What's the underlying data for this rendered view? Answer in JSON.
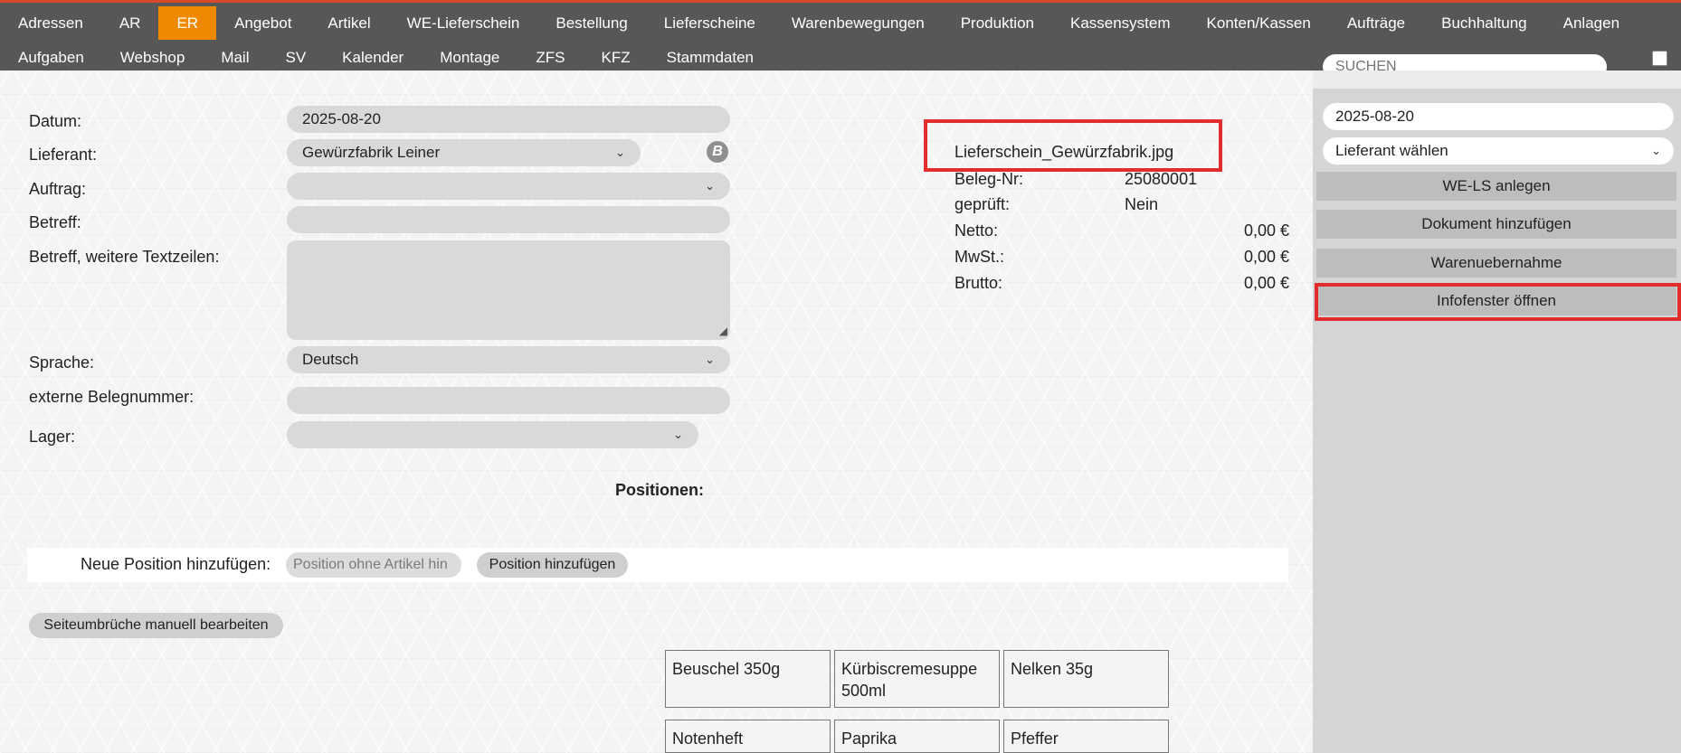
{
  "nav": {
    "row1": [
      "Adressen",
      "AR",
      "ER",
      "Angebot",
      "Artikel",
      "WE-Lieferschein",
      "Bestellung",
      "Lieferscheine",
      "Warenbewegungen",
      "Produktion",
      "Kassensystem",
      "Konten/Kassen",
      "Aufträge",
      "Buchhaltung",
      "Anlagen"
    ],
    "row2": [
      "Aufgaben",
      "Webshop",
      "Mail",
      "SV",
      "Kalender",
      "Montage",
      "ZFS",
      "KFZ",
      "Stammdaten"
    ],
    "active": "ER"
  },
  "sidebar": {
    "search_placeholder": "SUCHEN",
    "date": "2025-08-20",
    "supplier_select": "Lieferant wählen",
    "buttons": [
      "WE-LS anlegen",
      "Dokument hinzufügen",
      "Warenuebernahme",
      "Infofenster öffnen"
    ]
  },
  "form": {
    "datum_label": "Datum:",
    "datum_value": "2025-08-20",
    "lieferant_label": "Lieferant:",
    "lieferant_value": "Gewürzfabrik Leiner",
    "b_icon": "B",
    "auftrag_label": "Auftrag:",
    "auftrag_value": "",
    "betreff_label": "Betreff:",
    "betreff_value": "",
    "betreff_more_label": "Betreff, weitere Textzeilen:",
    "sprache_label": "Sprache:",
    "sprache_value": "Deutsch",
    "extern_label": "externe Belegnummer:",
    "extern_value": "",
    "lager_label": "Lager:",
    "lager_value": ""
  },
  "info": {
    "filename": "Lieferschein_Gewürzfabrik.jpg",
    "beleg_label": "Beleg-Nr:",
    "beleg_value": "25080001",
    "geprueft_label": "geprüft:",
    "geprueft_value": "Nein",
    "netto_label": "Netto:",
    "netto_value": "0,00 €",
    "mwst_label": "MwSt.:",
    "mwst_value": "0,00 €",
    "brutto_label": "Brutto:",
    "brutto_value": "0,00 €"
  },
  "positions": {
    "heading": "Positionen:",
    "new_label": "Neue Position hinzufügen:",
    "input_placeholder": "Position ohne Artikel hin",
    "add_button": "Position hinzufügen",
    "page_break_button": "Seiteumbrüche manuell bearbeiten"
  },
  "article_tiles": [
    "Beuschel 350g",
    "Kürbiscremesuppe 500ml",
    "Nelken 35g",
    "Notenheft",
    "Paprika",
    "Pfeffer"
  ],
  "colors": {
    "topbar": "#575757",
    "active_tab": "#ef8a00",
    "highlight": "#e32d2d",
    "sidebar": "#d5d5d5"
  }
}
